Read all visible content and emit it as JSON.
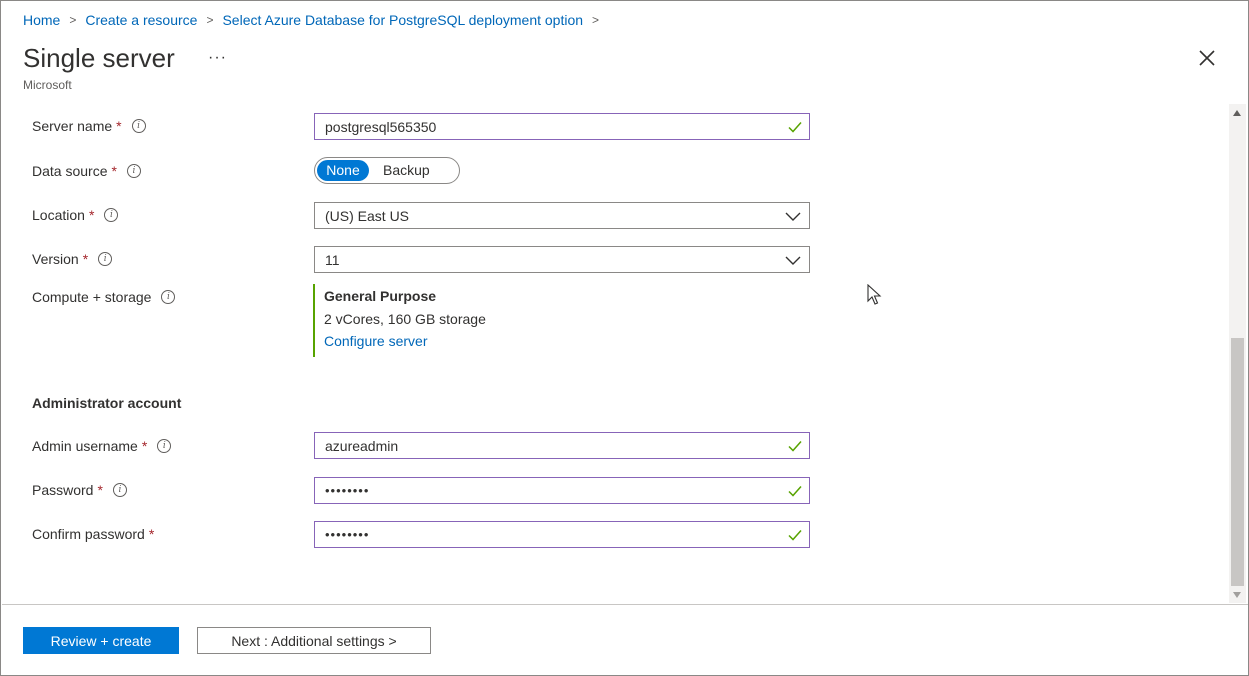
{
  "breadcrumb": {
    "items": [
      "Home",
      "Create a resource",
      "Select Azure Database for PostgreSQL deployment option"
    ]
  },
  "header": {
    "title": "Single server",
    "more": "···",
    "subtitle": "Microsoft"
  },
  "form": {
    "server_name": {
      "label": "Server name",
      "required": "*",
      "value": "postgresql565350"
    },
    "data_source": {
      "label": "Data source",
      "required": "*",
      "options": [
        "None",
        "Backup"
      ],
      "selected": "None"
    },
    "location": {
      "label": "Location",
      "required": "*",
      "value": "(US) East US"
    },
    "version": {
      "label": "Version",
      "required": "*",
      "value": "11"
    },
    "compute": {
      "label": "Compute + storage",
      "tier": "General Purpose",
      "spec": "2 vCores, 160 GB storage",
      "link": "Configure server"
    },
    "admin_section": "Administrator account",
    "admin_username": {
      "label": "Admin username",
      "required": "*",
      "value": "azureadmin"
    },
    "password": {
      "label": "Password",
      "required": "*",
      "value": "••••••••"
    },
    "confirm_password": {
      "label": "Confirm password",
      "required": "*",
      "value": "••••••••"
    }
  },
  "footer": {
    "review_label": "Review + create",
    "next_label": "Next : Additional settings >"
  },
  "colors": {
    "accent": "#0078d4",
    "link": "#0067b8",
    "valid_border": "#8764b8",
    "check": "#57a300",
    "required": "#a4262c"
  }
}
